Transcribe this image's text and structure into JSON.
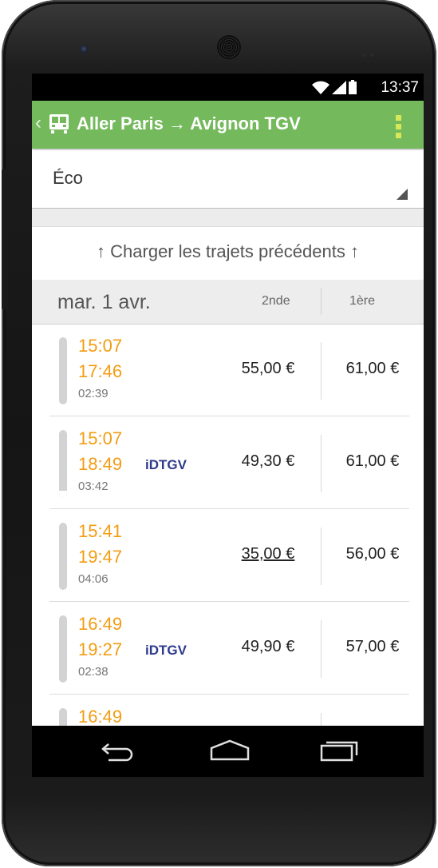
{
  "status_bar": {
    "time": "13:37"
  },
  "app_bar": {
    "title": "Aller Paris → Avignon TGV",
    "back_icon": "chevron-left-icon",
    "train_icon": "train-icon",
    "menu_icon": "overflow-menu-icon",
    "color": "#74b95c"
  },
  "class_select": {
    "value": "Éco"
  },
  "load_previous": {
    "label": "↑ Charger les trajets précédents ↑"
  },
  "date_header": {
    "date": "mar. 1 avr.",
    "col_second": "2nde",
    "col_first": "1ère"
  },
  "trips": [
    {
      "departure": "15:07",
      "arrival": "17:46",
      "duration": "02:39",
      "carrier": "",
      "price_second": "55,00 €",
      "price_first": "61,00 €"
    },
    {
      "departure": "15:07",
      "arrival": "18:49",
      "duration": "03:42",
      "carrier": "iDTGV",
      "price_second": "49,30 €",
      "price_first": "61,00 €"
    },
    {
      "departure": "15:41",
      "arrival": "19:47",
      "duration": "04:06",
      "carrier": "",
      "price_second": "35,00 €",
      "price_first": "56,00 €"
    },
    {
      "departure": "16:49",
      "arrival": "19:27",
      "duration": "02:38",
      "carrier": "iDTGV",
      "price_second": "49,90 €",
      "price_first": "57,00 €"
    },
    {
      "departure": "16:49"
    }
  ],
  "colors": {
    "time_orange": "#f39c12",
    "carrier_blue": "#2e3a8c"
  }
}
